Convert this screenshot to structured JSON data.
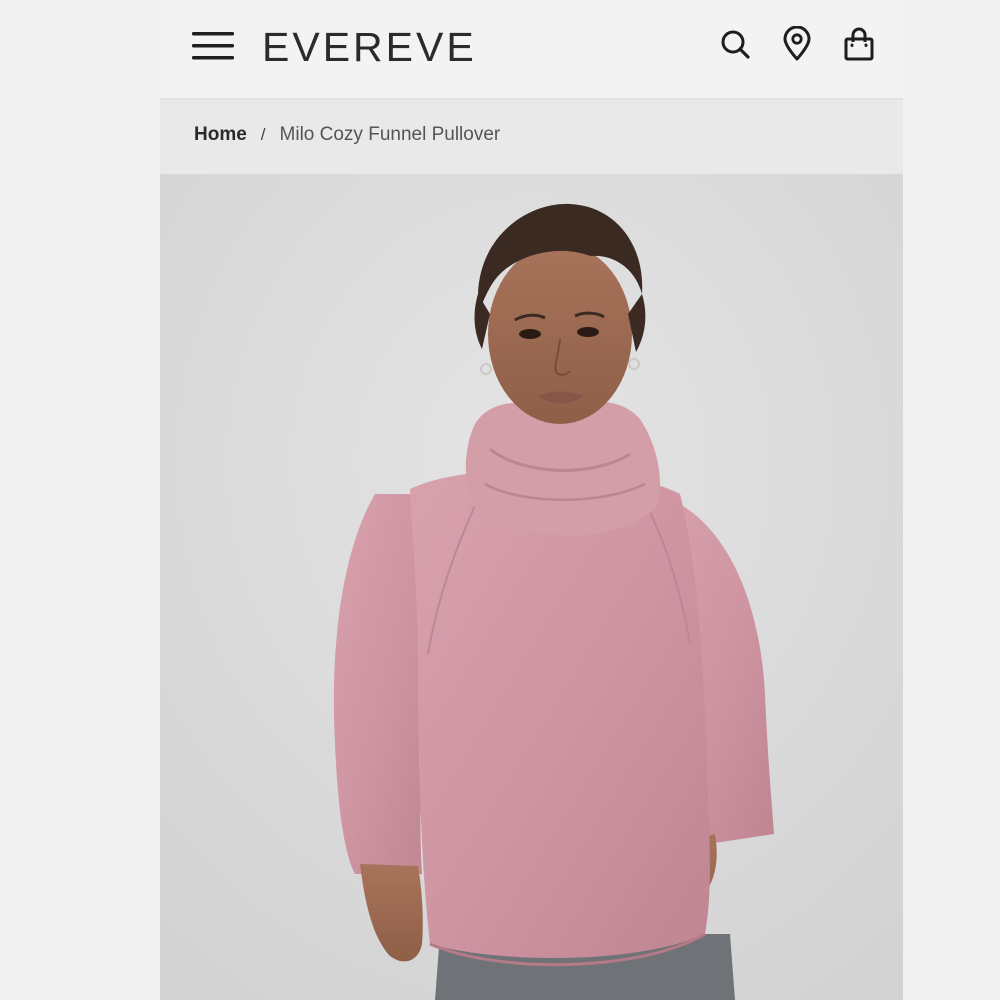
{
  "header": {
    "brand": "EVEREVE",
    "menu_icon": "hamburger-menu-icon",
    "icons": [
      "search-icon",
      "location-pin-icon",
      "shopping-bag-icon"
    ]
  },
  "breadcrumb": {
    "home": "Home",
    "separator": "/",
    "current": "Milo Cozy Funnel Pullover"
  },
  "product": {
    "image_icon": "product-photo",
    "garment_color": "#d39aa6"
  },
  "colors": {
    "background": "#f3f3f3",
    "breadcrumb_bg": "#e9e9e9",
    "text": "#2b2b2b"
  }
}
